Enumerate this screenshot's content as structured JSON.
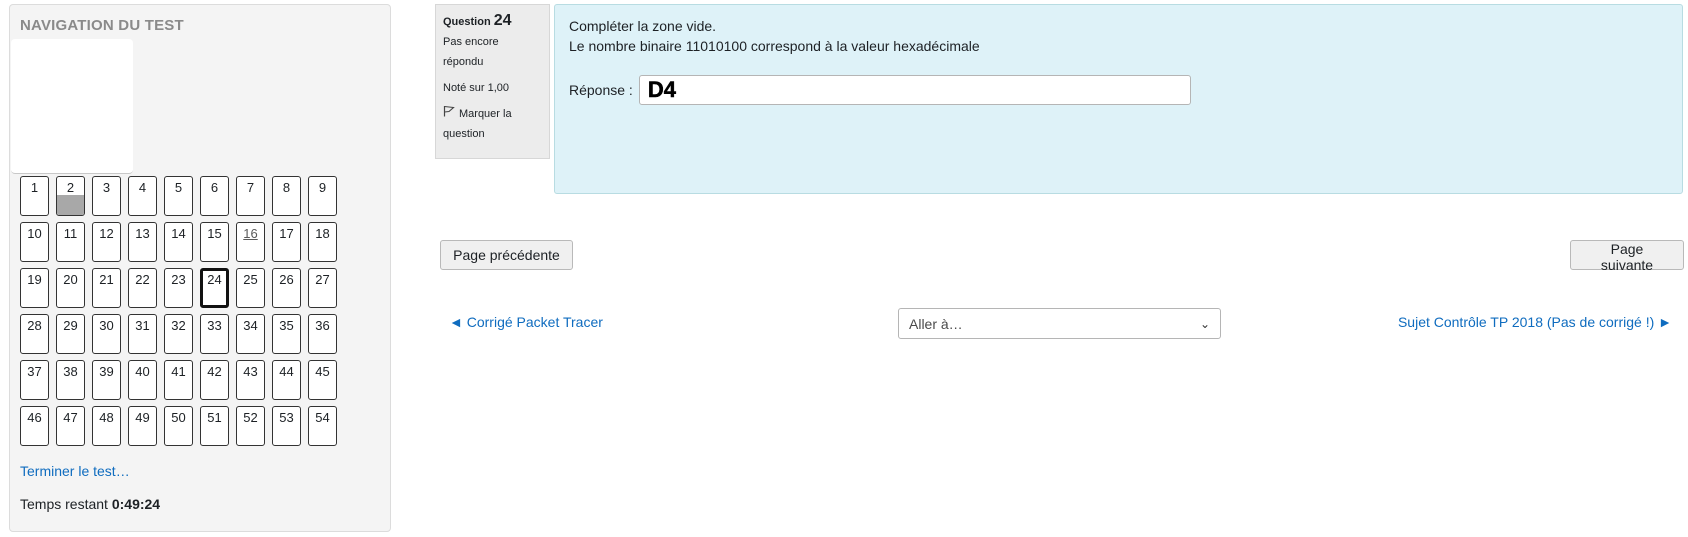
{
  "nav": {
    "title": "NAVIGATION DU TEST",
    "questions": [
      "1",
      "2",
      "3",
      "4",
      "5",
      "6",
      "7",
      "8",
      "9",
      "10",
      "11",
      "12",
      "13",
      "14",
      "15",
      "16",
      "17",
      "18",
      "19",
      "20",
      "21",
      "22",
      "23",
      "24",
      "25",
      "26",
      "27",
      "28",
      "29",
      "30",
      "31",
      "32",
      "33",
      "34",
      "35",
      "36",
      "37",
      "38",
      "39",
      "40",
      "41",
      "42",
      "43",
      "44",
      "45",
      "46",
      "47",
      "48",
      "49",
      "50",
      "51",
      "52",
      "53",
      "54"
    ],
    "current_question": "24",
    "answered_questions": [
      "2"
    ],
    "underlined_questions": [
      "16"
    ],
    "finish_link": "Terminer le test…",
    "timer_label": "Temps restant",
    "timer_value": "0:49:24"
  },
  "question": {
    "label": "Question",
    "number": "24",
    "state": "Pas encore répondu",
    "grade": "Noté sur 1,00",
    "flag_label": "Marquer la question",
    "instruction": "Compléter la zone vide.",
    "text": "Le nombre binaire 11010100 correspond à la valeur hexadécimale",
    "answer_label": "Réponse :",
    "answer_value": "D4"
  },
  "buttons": {
    "prev_page": "Page précédente",
    "next_page": "Page suivante"
  },
  "activity_nav": {
    "prev": "◄ Corrigé Packet Tracer",
    "jump_placeholder": "Aller à…",
    "next": "Sujet Contrôle TP 2018 (Pas de corrigé !) ►"
  },
  "colors": {
    "link": "#0f6cbf",
    "question_bg": "#def2f8",
    "info_bg": "#ececec",
    "answered_fill": "#a8a8a8"
  }
}
